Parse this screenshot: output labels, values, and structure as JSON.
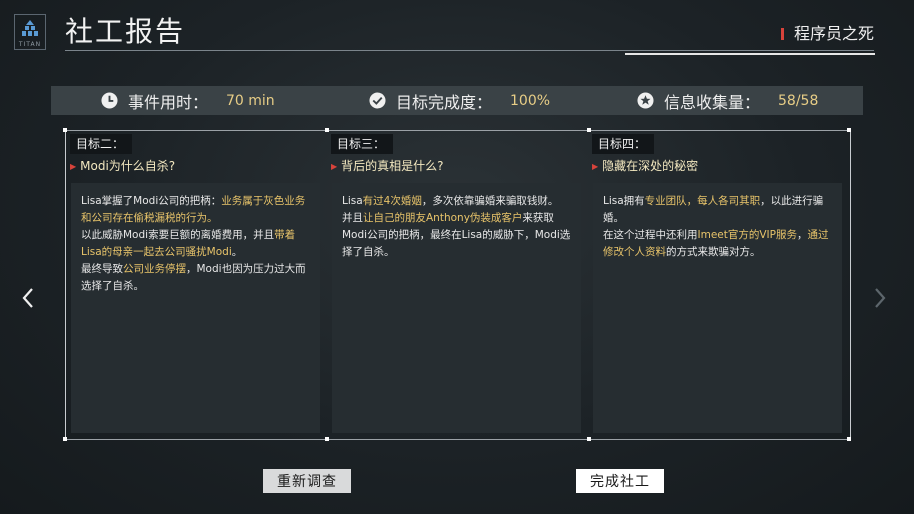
{
  "logo": {
    "text": "TITAN"
  },
  "header": {
    "title": "社工报告",
    "case_name": "程序员之死"
  },
  "stats": {
    "time": {
      "label": "事件用时：",
      "value": "70 min",
      "icon": "clock-icon"
    },
    "completion": {
      "label": "目标完成度：",
      "value": "100%",
      "icon": "check-circle-icon"
    },
    "info": {
      "label": "信息收集量：",
      "value": "58/58",
      "icon": "star-circle-icon"
    }
  },
  "goals": [
    {
      "tag": "目标二：",
      "question": "Modi为什么自杀?",
      "body": [
        [
          [
            "Lisa掌握了Modi公司的把柄：",
            false
          ],
          [
            "业务属于灰色业务和公司存在偷税漏税的行为。",
            true
          ]
        ],
        [
          [
            "以此威胁Modi索要巨额的离婚费用，并且",
            false
          ],
          [
            "带着Lisa的母亲一起去公司骚扰Modi",
            true
          ],
          [
            "。",
            false
          ]
        ],
        [
          [
            "最终导致",
            false
          ],
          [
            "公司业务停摆",
            true
          ],
          [
            "，Modi也因为压力过大而选择了自杀。",
            false
          ]
        ]
      ]
    },
    {
      "tag": "目标三：",
      "question": "背后的真相是什么?",
      "body": [
        [
          [
            "Lisa",
            false
          ],
          [
            "有过4次婚姻",
            true
          ],
          [
            "，多次依靠骗婚来骗取钱财。",
            false
          ]
        ],
        [
          [
            "并且",
            false
          ],
          [
            "让自己的朋友Anthony伪装成客户",
            true
          ],
          [
            "来获取Modi公司的把柄，最终在Lisa的威胁下，Modi选择了自杀。",
            false
          ]
        ]
      ]
    },
    {
      "tag": "目标四：",
      "question": "隐藏在深处的秘密",
      "body": [
        [
          [
            "Lisa拥有",
            false
          ],
          [
            "专业团队，每人各司其职",
            true
          ],
          [
            "，以此进行骗婚。",
            false
          ]
        ],
        [
          [
            "在这个过程中还利用",
            false
          ],
          [
            "Imeet官方的VIP服务",
            true
          ],
          [
            "，",
            false
          ],
          [
            "通过修改个人资料",
            true
          ],
          [
            "的方式来欺骗对方。",
            false
          ]
        ]
      ]
    }
  ],
  "buttons": {
    "reinvestigate": "重新调查",
    "complete": "完成社工"
  },
  "nav": {
    "prev_icon": "chevron-left-icon",
    "next_icon": "chevron-right-icon"
  },
  "colors": {
    "highlight": "#e8c46a",
    "accent_red": "#d8433b",
    "stat_value": "#e7cd86"
  }
}
